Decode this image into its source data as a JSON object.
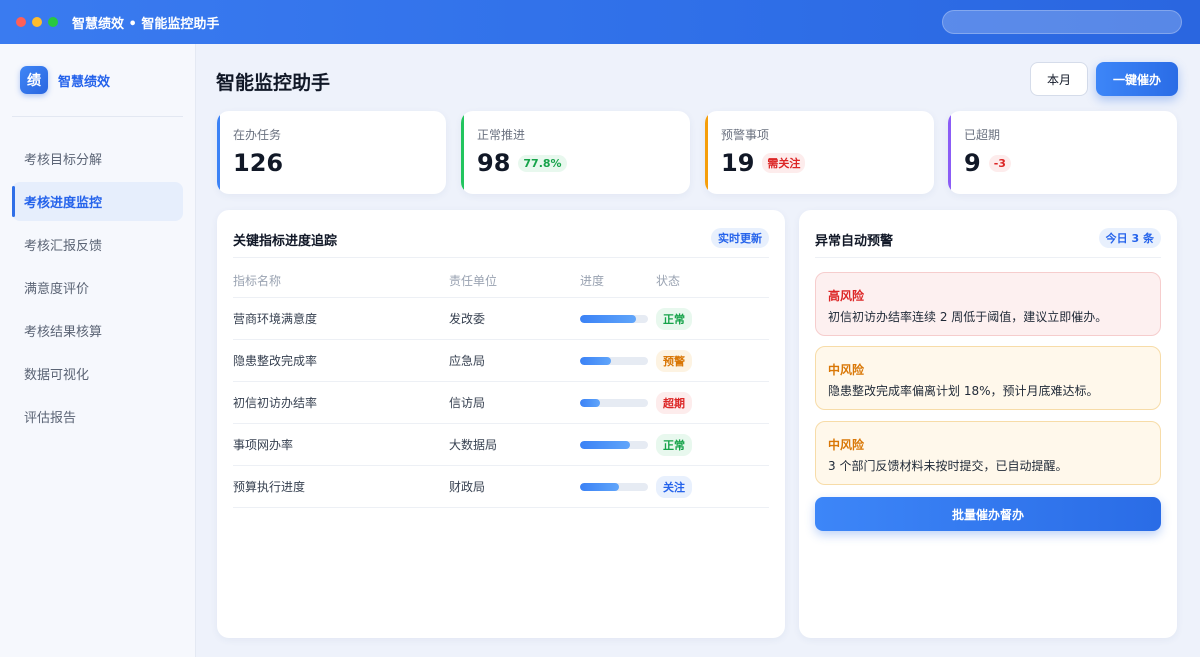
{
  "window": {
    "title": "智慧绩效 • 智能监控助手"
  },
  "sidebar": {
    "brand_logo": "绩",
    "brand_name": "智慧绩效",
    "items": [
      {
        "label": "考核目标分解",
        "active": false
      },
      {
        "label": "考核进度监控",
        "active": true
      },
      {
        "label": "考核汇报反馈",
        "active": false
      },
      {
        "label": "满意度评价",
        "active": false
      },
      {
        "label": "考核结果核算",
        "active": false
      },
      {
        "label": "数据可视化",
        "active": false
      },
      {
        "label": "评估报告",
        "active": false
      }
    ]
  },
  "header": {
    "title": "智能监控助手",
    "month_button": "本月",
    "urge_button": "一键催办"
  },
  "stats": [
    {
      "label": "在办任务",
      "value": "126",
      "tag": ""
    },
    {
      "label": "正常推进",
      "value": "98",
      "tag": "77.8%"
    },
    {
      "label": "预警事项",
      "value": "19",
      "tag": "需关注"
    },
    {
      "label": "已超期",
      "value": "9",
      "tag": "-3"
    }
  ],
  "tracking": {
    "title": "关键指标进度追踪",
    "badge": "实时更新",
    "columns": [
      "指标名称",
      "责任单位",
      "进度",
      "状态"
    ],
    "rows": [
      {
        "name": "营商环境满意度",
        "unit": "发改委",
        "progress": 0.82,
        "status": "正常",
        "status_type": "normal"
      },
      {
        "name": "隐患整改完成率",
        "unit": "应急局",
        "progress": 0.45,
        "status": "预警",
        "status_type": "warn"
      },
      {
        "name": "初信初访办结率",
        "unit": "信访局",
        "progress": 0.3,
        "status": "超期",
        "status_type": "over"
      },
      {
        "name": "事项网办率",
        "unit": "大数据局",
        "progress": 0.74,
        "status": "正常",
        "status_type": "normal"
      },
      {
        "name": "预算执行进度",
        "unit": "财政局",
        "progress": 0.58,
        "status": "关注",
        "status_type": "watch"
      }
    ]
  },
  "alerts": {
    "title": "异常自动预警",
    "badge": "今日 3 条",
    "items": [
      {
        "level": "高风险",
        "text": "初信初访办结率连续 2 周低于阈值，建议立即催办。"
      },
      {
        "level": "中风险",
        "text": "隐患整改完成率偏离计划 18%，预计月底难达标。"
      },
      {
        "level": "中风险",
        "text": "3 个部门反馈材料未按时提交，已自动提醒。"
      }
    ],
    "batch_button": "批量催办督办"
  }
}
